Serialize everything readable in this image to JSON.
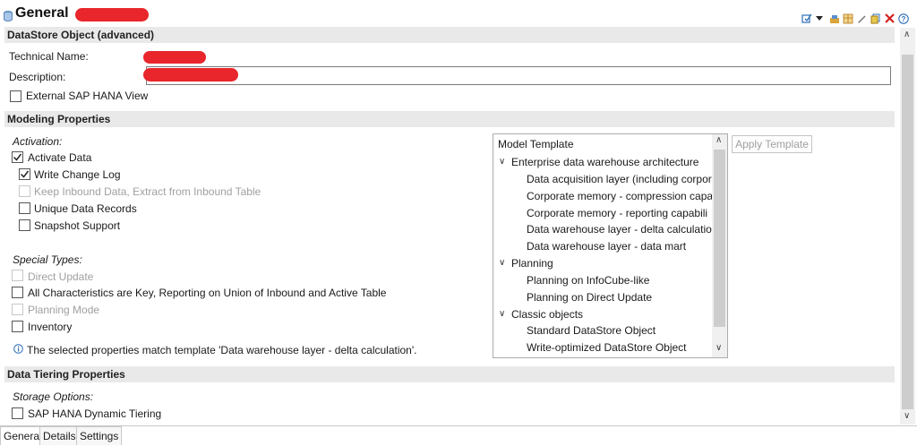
{
  "header": {
    "title": "General",
    "toolbar_icons": [
      "activate-icon",
      "dropdown-arrow-icon",
      "manage-icon",
      "table-icon",
      "edit-icon",
      "copy-icon",
      "delete-icon",
      "help-icon"
    ]
  },
  "sections": {
    "datastore": "DataStore Object (advanced)",
    "modeling": "Modeling Properties",
    "tiering": "Data Tiering Properties"
  },
  "general": {
    "technical_name_label": "Technical Name:",
    "description_label": "Description:",
    "external_view_label": "External SAP HANA View",
    "external_view_checked": false
  },
  "modeling": {
    "activation_label": "Activation:",
    "activate_data": "Activate Data",
    "write_change_log": "Write Change Log",
    "keep_inbound": "Keep Inbound Data, Extract from Inbound Table",
    "unique_records": "Unique Data Records",
    "snapshot_support": "Snapshot Support",
    "special_types_label": "Special Types:",
    "direct_update": "Direct Update",
    "all_characteristics": "All Characteristics are Key, Reporting on Union of Inbound and Active Table",
    "planning_mode": "Planning Mode",
    "inventory": "Inventory",
    "info_text": "The selected properties match template 'Data warehouse layer - delta calculation'."
  },
  "template": {
    "header": "Model Template",
    "apply_button": "Apply Template",
    "groups": [
      {
        "label": "Enterprise data warehouse architecture",
        "items": [
          "Data acquisition layer (including corpor",
          "Corporate memory - compression capa",
          "Corporate memory - reporting capabili",
          "Data warehouse layer - delta calculation",
          "Data warehouse layer - data mart"
        ]
      },
      {
        "label": "Planning",
        "items": [
          "Planning on InfoCube-like",
          "Planning on Direct Update"
        ]
      },
      {
        "label": "Classic objects",
        "items": [
          "Standard DataStore Object",
          "Write-optimized DataStore Object"
        ]
      }
    ]
  },
  "tiering": {
    "storage_label": "Storage Options:",
    "dynamic_tiering": "SAP HANA Dynamic Tiering"
  },
  "tabs": [
    "General",
    "Details",
    "Settings"
  ],
  "active_tab": "General"
}
